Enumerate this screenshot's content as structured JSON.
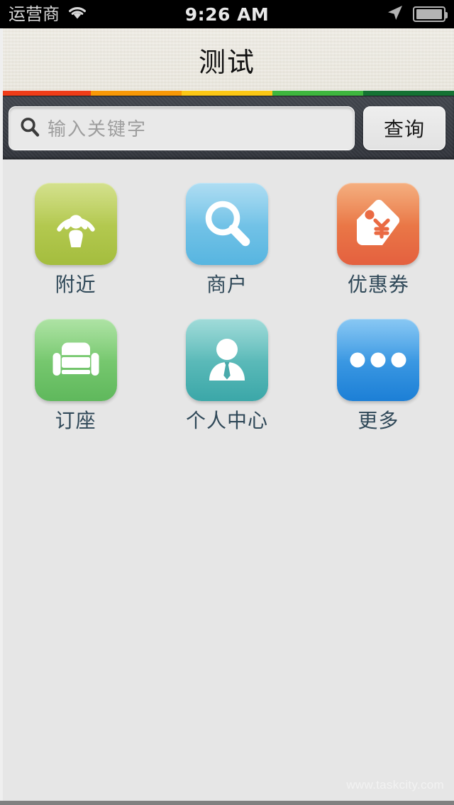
{
  "status_bar": {
    "carrier": "运营商",
    "wifi_icon": "wifi-icon",
    "time": "9:26 AM",
    "location_icon": "location-arrow-icon",
    "battery_icon": "battery-icon"
  },
  "title_bar": {
    "title": "测试"
  },
  "color_stripe": {
    "segments": [
      {
        "name": "red",
        "color": "#f03c18",
        "width_pct": 20.0
      },
      {
        "name": "orange",
        "color": "#f99806",
        "width_pct": 20.0
      },
      {
        "name": "yellow",
        "color": "#fcc715",
        "width_pct": 20.0
      },
      {
        "name": "green",
        "color": "#3eb63e",
        "width_pct": 20.0
      },
      {
        "name": "dark-green",
        "color": "#147233",
        "width_pct": 20.0
      }
    ]
  },
  "search": {
    "icon": "search-icon",
    "value": "",
    "placeholder": "输入关键字",
    "button_label": "查询"
  },
  "grid": {
    "items": [
      {
        "label": "附近",
        "icon": "broadcast-person-icon",
        "color_from": "#c3d562",
        "color_to": "#a4bd3e"
      },
      {
        "label": "商户",
        "icon": "magnifier-icon",
        "color_from": "#8fd0ee",
        "color_to": "#57b5e0"
      },
      {
        "label": "优惠券",
        "icon": "price-tag-yen-icon",
        "color_from": "#f0904f",
        "color_to": "#e4603f"
      },
      {
        "label": "订座",
        "icon": "armchair-icon",
        "color_from": "#8fd882",
        "color_to": "#5fb85c"
      },
      {
        "label": "个人中心",
        "icon": "person-tie-icon",
        "color_from": "#7ccdca",
        "color_to": "#3ba7a8"
      },
      {
        "label": "更多",
        "icon": "ellipsis-icon",
        "color_from": "#5bb2ef",
        "color_to": "#1c7fd6"
      }
    ]
  },
  "watermark": {
    "text": "www.taskcity.com"
  },
  "colors": {
    "page_background": "#e6e6e6",
    "title_background": "#eeeade",
    "searchbar_background": "#3c4049",
    "label_text": "#2f4858"
  }
}
